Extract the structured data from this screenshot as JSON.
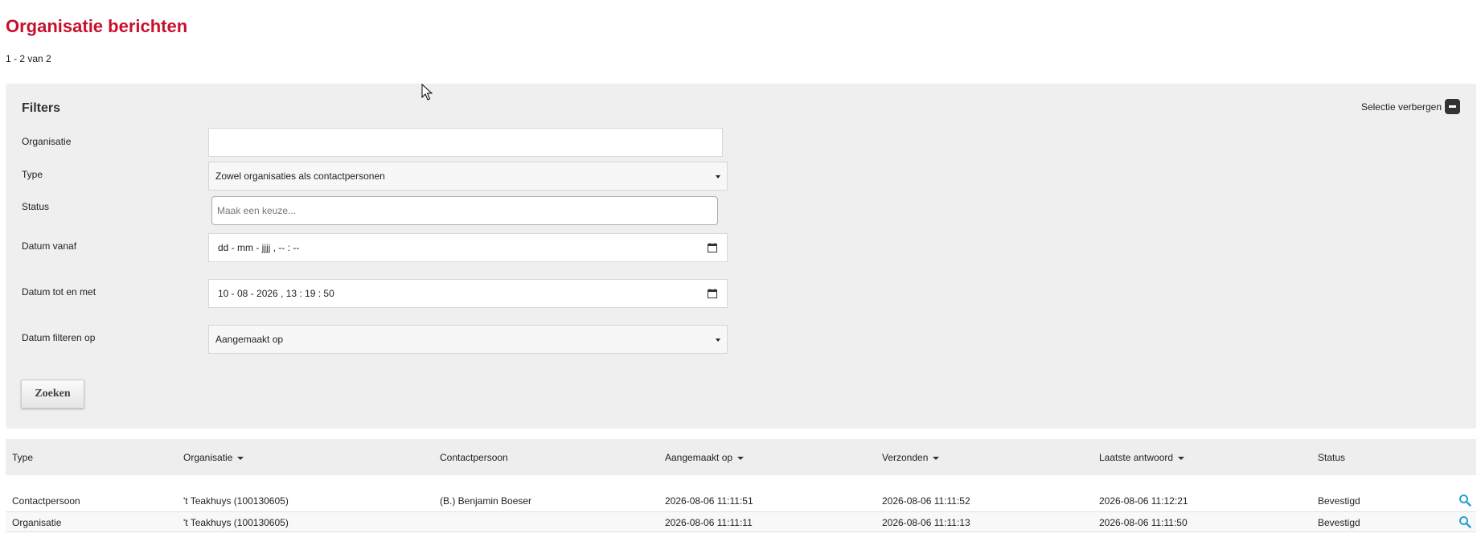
{
  "page": {
    "title": "Organisatie berichten",
    "result_count": "1 - 2 van 2"
  },
  "filters": {
    "title": "Filters",
    "toggle_label": "Selectie verbergen",
    "organisatie": {
      "label": "Organisatie",
      "value": ""
    },
    "type": {
      "label": "Type",
      "value": "Zowel organisaties als contactpersonen"
    },
    "status": {
      "label": "Status",
      "placeholder": "Maak een keuze..."
    },
    "datum_vanaf": {
      "label": "Datum vanaf",
      "value": "dd - mm - jjjj ,  -- : --"
    },
    "datum_tot": {
      "label": "Datum tot en met",
      "value": "10 - 08 - 2026 ,  13 : 19 : 50"
    },
    "datum_filteren": {
      "label": "Datum filteren op",
      "value": "Aangemaakt op"
    },
    "search_button": "Zoeken"
  },
  "table": {
    "headers": {
      "type": "Type",
      "organisatie": "Organisatie",
      "contactpersoon": "Contactpersoon",
      "aangemaakt": "Aangemaakt op",
      "verzonden": "Verzonden",
      "laatste": "Laatste antwoord",
      "status": "Status"
    },
    "rows": [
      {
        "type": "Contactpersoon",
        "organisatie": "'t Teakhuys (100130605)",
        "contactpersoon": "(B.) Benjamin Boeser",
        "aangemaakt": "2026-08-06 11:11:51",
        "verzonden": "2026-08-06 11:11:52",
        "laatste": "2026-08-06 11:12:21",
        "status": "Bevestigd"
      },
      {
        "type": "Organisatie",
        "organisatie": "'t Teakhuys (100130605)",
        "contactpersoon": "",
        "aangemaakt": "2026-08-06 11:11:11",
        "verzonden": "2026-08-06 11:11:13",
        "laatste": "2026-08-06 11:11:50",
        "status": "Bevestigd"
      }
    ]
  },
  "colors": {
    "title": "#c8102e",
    "accent_icon": "#2a9fd6",
    "panel": "#efefef"
  },
  "icons": [
    "cursor-icon",
    "calendar-icon",
    "search-icon",
    "minus-icon"
  ]
}
